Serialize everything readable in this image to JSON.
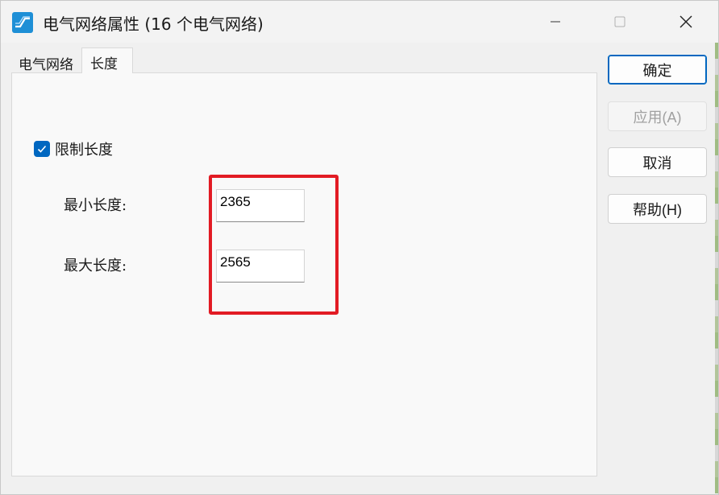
{
  "window": {
    "title": "电气网络属性 (16 个电气网络)",
    "icon": "network-app-icon"
  },
  "tabs": [
    {
      "label": "电气网络",
      "active": false
    },
    {
      "label": "长度",
      "active": true
    }
  ],
  "length_tab": {
    "limit_checkbox": {
      "label": "限制长度",
      "checked": true
    },
    "min_length": {
      "label": "最小长度:",
      "value": "2365"
    },
    "max_length": {
      "label": "最大长度:",
      "value": "2565"
    }
  },
  "buttons": {
    "ok": "确定",
    "apply": "应用(A)",
    "cancel": "取消",
    "help": "帮助(H)"
  },
  "colors": {
    "accent": "#0067c0",
    "highlight": "#e21b24"
  }
}
